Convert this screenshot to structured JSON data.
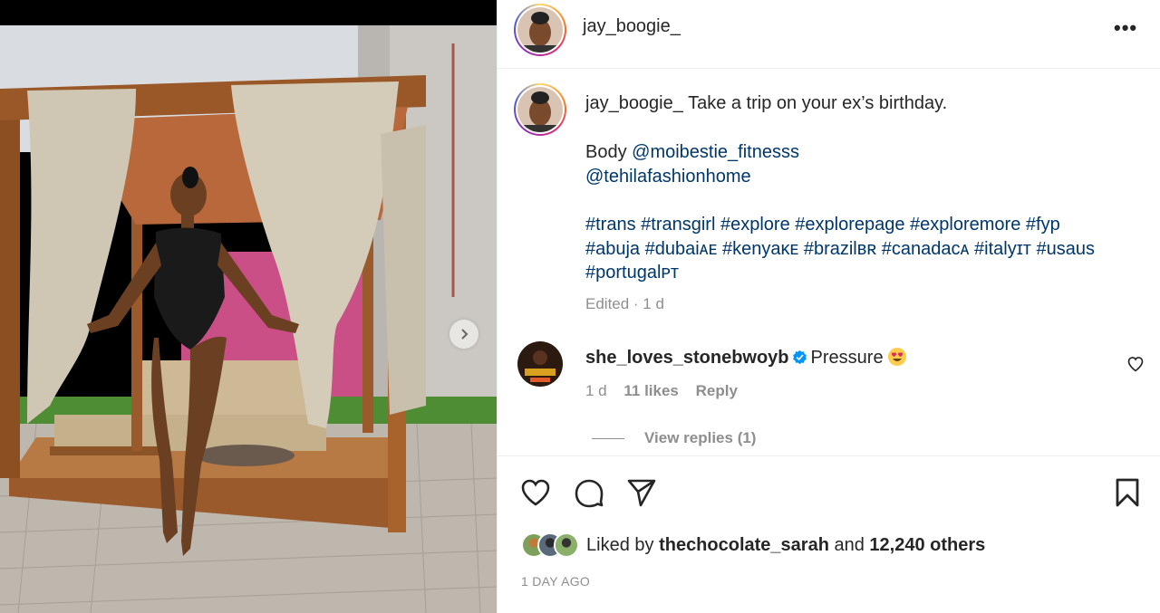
{
  "post": {
    "username": "jay_boogie_",
    "more_label": "•••"
  },
  "caption": {
    "username": "jay_boogie_",
    "text": "Take a trip on your ex’s birthday.",
    "body_prefix": "Body",
    "mention1": "@moibestie_fitnesss",
    "mention2": "@tehilafashionhome",
    "tags_line1": [
      "#trans",
      "#transgirl",
      "#explore",
      "#explorepage",
      "#exploremore",
      "#fyp"
    ],
    "tags_line2": [
      "#abuja",
      "#dubaiᴀᴇ",
      "#kenyaᴋᴇ",
      "#brazilʙʀ",
      "#canadaᴄᴀ",
      "#italyɪᴛ",
      "#usaus"
    ],
    "tags_line3": [
      "#portugalᴘᴛ"
    ],
    "edited": "Edited · 1 d"
  },
  "comment": {
    "username": "she_loves_stonebwoyb",
    "text": "Pressure",
    "time": "1 d",
    "likes": "11 likes",
    "reply": "Reply",
    "view_replies": "View replies (1)"
  },
  "likes": {
    "prefix": "Liked by",
    "user": "thechocolate_sarah",
    "middle": "and",
    "count": "12,240 others"
  },
  "timestamp": "1 DAY AGO",
  "icons": {
    "like": "heart-icon",
    "comment": "comment-icon",
    "share": "paper-plane-icon",
    "save": "bookmark-icon",
    "next": "chevron-right-icon",
    "verified": "verified-badge-icon",
    "emoji": "heart-eyes-emoji"
  },
  "colors": {
    "link": "#00376b",
    "muted": "#8e8e8e",
    "verified": "#0095f6"
  }
}
